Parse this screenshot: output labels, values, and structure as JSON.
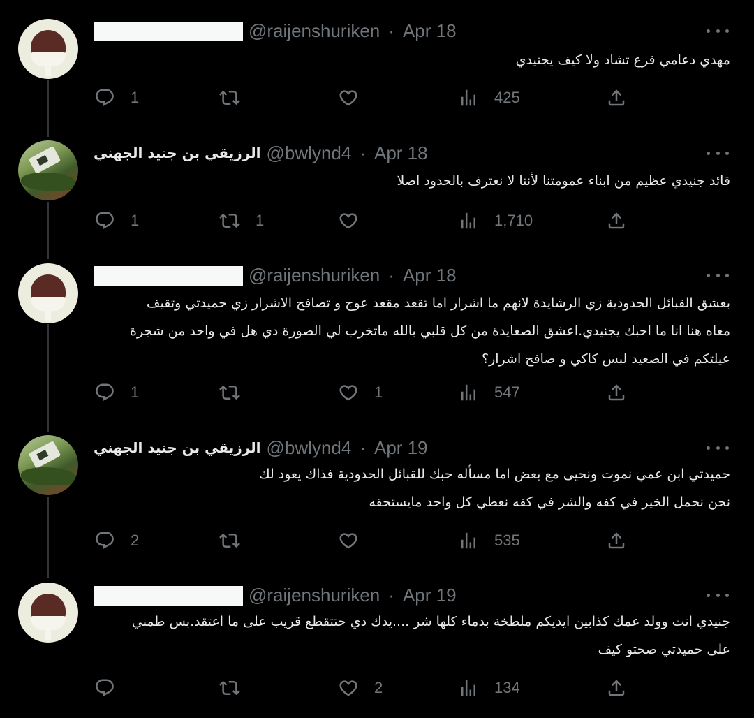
{
  "thread": {
    "tweets": [
      {
        "author_kind": "redacted",
        "display_name": "",
        "handle": "@raijenshuriken",
        "date": "Apr 18",
        "text_lines": [
          "مهدي دعامي فرع تشاد ولا كيف يجنيدي"
        ],
        "reply_count": "1",
        "retweet_count": "",
        "like_count": "",
        "view_count": "425"
      },
      {
        "author_kind": "named",
        "display_name": "الرزيقي بن جنيد الجهني",
        "handle": "@bwlynd4",
        "date": "Apr 18",
        "text_lines": [
          "قائد جنيدي عظيم من ابناء عمومتنا لأننا لا نعترف بالحدود اصلا"
        ],
        "reply_count": "1",
        "retweet_count": "1",
        "like_count": "",
        "view_count": "1,710"
      },
      {
        "author_kind": "redacted",
        "display_name": "",
        "handle": "@raijenshuriken",
        "date": "Apr 18",
        "text_lines": [
          "بعشق القبائل الحدودية زي الرشايدة لانهم ما اشرار اما تقعد مقعد عوج و تصافح الاشرار زي حميدتي وتقيف",
          "معاه هنا انا ما احبك يجنيدي.اعشق الصعايدة من كل قلبي بالله ماتخرب لي الصورة دي هل في واحد من شجرة",
          "عيلتكم في الصعيد لبس كاكي و صافح اشرار؟"
        ],
        "reply_count": "1",
        "retweet_count": "",
        "like_count": "1",
        "view_count": "547"
      },
      {
        "author_kind": "named",
        "display_name": "الرزيقي بن جنيد الجهني",
        "handle": "@bwlynd4",
        "date": "Apr 19",
        "text_lines": [
          "حميدتي ابن عمي نموت ونحيى مع بعض اما مسأله حبك للقبائل الحدودية فذاك يعود لك",
          "نحن نحمل الخير في كفه والشر في كفه نعطي كل واحد مايستحقه"
        ],
        "reply_count": "2",
        "retweet_count": "",
        "like_count": "",
        "view_count": "535"
      },
      {
        "author_kind": "redacted",
        "display_name": "",
        "handle": "@raijenshuriken",
        "date": "Apr 19",
        "text_lines": [
          "جنيدي انت وولد عمك كذابين ايديكم ملطخة بدماء كلها شر ....يدك دي حتتقطع قريب على ما اعتقد.بس طمني",
          "على حميدتي صحتو كيف"
        ],
        "reply_count": "",
        "retweet_count": "",
        "like_count": "2",
        "view_count": "134"
      }
    ]
  },
  "colors": {
    "background": "#000000",
    "text": "#e7e9ea",
    "muted": "#71767b",
    "thread_line": "#333639",
    "redaction": "#f7f9f9"
  },
  "icons": {
    "reply": "reply-icon",
    "retweet": "retweet-icon",
    "like": "heart-icon",
    "views": "views-icon",
    "share": "share-icon",
    "more": "more-icon"
  }
}
